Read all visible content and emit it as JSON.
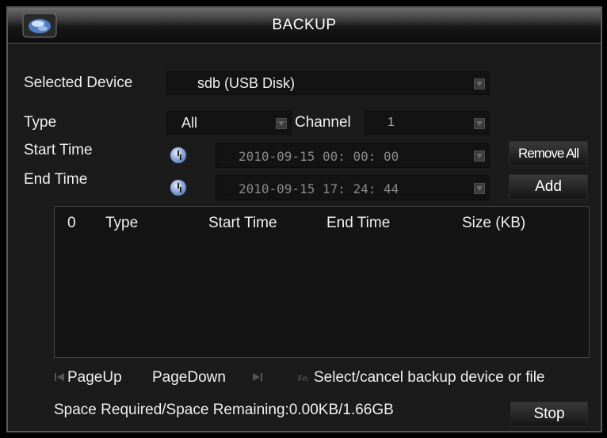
{
  "window": {
    "title": "BACKUP"
  },
  "form": {
    "selected_device_label": "Selected Device",
    "selected_device_value": "sdb (USB Disk)",
    "type_label": "Type",
    "type_value": "All",
    "channel_label": "Channel",
    "channel_value": "1",
    "start_time_label": "Start Time",
    "start_time_value": "2010-09-15 00: 00: 00",
    "end_time_label": "End Time",
    "end_time_value": "2010-09-15 17: 24: 44"
  },
  "buttons": {
    "remove_all": "Remove All",
    "add": "Add",
    "stop": "Stop"
  },
  "table": {
    "columns": [
      "0",
      "Type",
      "Start Time",
      "End Time",
      "Size (KB)"
    ],
    "rows": []
  },
  "footer": {
    "page_up": "PageUp",
    "page_down": "PageDown",
    "fn_hint": "Select/cancel backup device or file",
    "space_info": "Space Required/Space Remaining:0.00KB/1.66GB"
  },
  "icons": [
    "app-logo-icon",
    "clock-icon",
    "dropdown-arrow-icon",
    "page-up-icon",
    "page-down-icon",
    "fn-key-icon"
  ]
}
